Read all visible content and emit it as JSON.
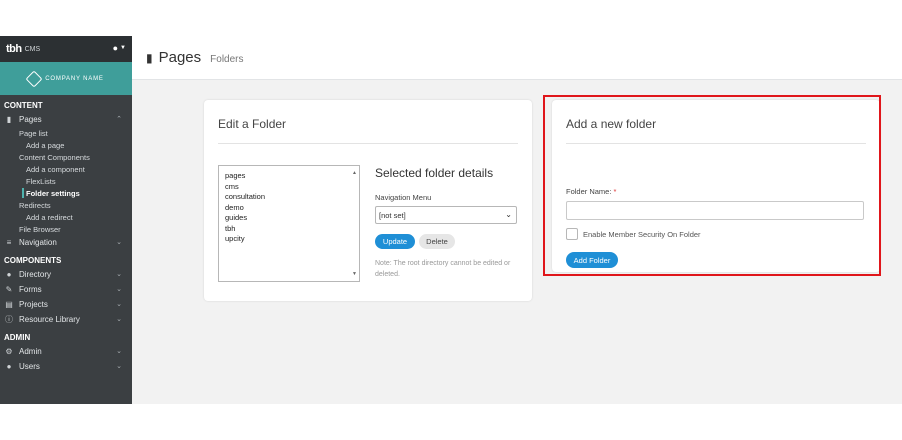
{
  "app": {
    "logo": "tbh",
    "logo_suffix": "CMS",
    "brand_name": "COMPANY NAME"
  },
  "sidebar": {
    "section_content": "CONTENT",
    "pages_label": "Pages",
    "pages_sub": [
      {
        "label": "Page list"
      },
      {
        "label": "Add a page"
      },
      {
        "label": "Content Components"
      },
      {
        "label": "Add a component"
      },
      {
        "label": "FlexLists"
      },
      {
        "label": "Folder settings"
      },
      {
        "label": "Redirects"
      },
      {
        "label": "Add a redirect"
      },
      {
        "label": "File Browser"
      }
    ],
    "navigation_label": "Navigation",
    "section_components": "COMPONENTS",
    "components": [
      {
        "label": "Directory"
      },
      {
        "label": "Forms"
      },
      {
        "label": "Projects"
      },
      {
        "label": "Resource Library"
      }
    ],
    "section_admin": "ADMIN",
    "admin": [
      {
        "label": "Admin"
      },
      {
        "label": "Users"
      }
    ]
  },
  "header": {
    "title": "Pages",
    "breadcrumb": "Folders"
  },
  "edit_folder": {
    "title": "Edit a Folder",
    "folders": [
      "pages",
      "cms",
      "consultation",
      "demo",
      "guides",
      "tbh",
      "upcity"
    ],
    "details_title": "Selected folder details",
    "nav_menu_label": "Navigation Menu",
    "nav_menu_value": "[not set]",
    "update_label": "Update",
    "delete_label": "Delete",
    "note": "Note: The root directory cannot be edited or deleted."
  },
  "add_folder": {
    "title": "Add a new folder",
    "name_label": "Folder Name:",
    "required_mark": "*",
    "name_value": "",
    "security_label": "Enable Member Security On Folder",
    "security_checked": false,
    "add_label": "Add Folder"
  },
  "colors": {
    "accent": "#1f8fd6",
    "brand": "#3f9e9a",
    "sidebar": "#3b3f42",
    "highlight": "#e0161b"
  }
}
